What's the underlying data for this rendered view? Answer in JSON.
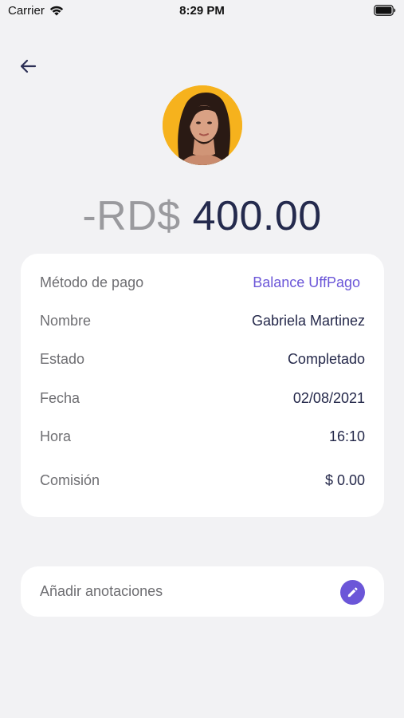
{
  "status_bar": {
    "carrier": "Carrier",
    "time": "8:29 PM",
    "icons": [
      "wifi-icon",
      "battery-icon"
    ]
  },
  "header": {
    "back_icon": "arrow-left-icon"
  },
  "transaction": {
    "sign_currency": "-RD$",
    "amount": "400.00"
  },
  "details": [
    {
      "label": "Método de pago",
      "value": "Balance UffPago"
    },
    {
      "label": "Nombre",
      "value": "Gabriela Martinez"
    },
    {
      "label": "Estado",
      "value": "Completado"
    },
    {
      "label": "Fecha",
      "value": "02/08/2021"
    },
    {
      "label": "Hora",
      "value": "16:10"
    },
    {
      "label": "Comisión",
      "value": "$ 0.00"
    }
  ],
  "notes": {
    "label": "Añadir anotaciones",
    "icon": "pencil-icon"
  },
  "colors": {
    "background": "#f2f2f4",
    "card": "#ffffff",
    "accent": "#6b56d8",
    "amount_dark": "#242a4d",
    "amount_muted": "#9a9a9e",
    "avatar_bg": "#f6b21d"
  }
}
